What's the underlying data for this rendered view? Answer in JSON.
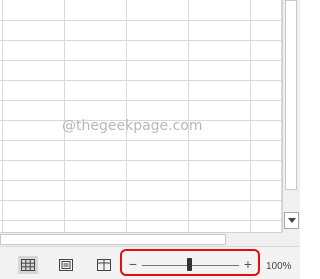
{
  "watermark": "@thegeekpage.com",
  "status_bar": {
    "view_buttons": [
      {
        "name": "normal-view",
        "icon": "grid-icon",
        "active": true
      },
      {
        "name": "page-layout-view",
        "icon": "page-layout-icon",
        "active": false
      },
      {
        "name": "page-break-preview",
        "icon": "page-break-icon",
        "active": false
      }
    ],
    "zoom": {
      "out_label": "−",
      "in_label": "+",
      "level": "100%",
      "level_value": 100,
      "highlight_color": "#e01010"
    }
  }
}
